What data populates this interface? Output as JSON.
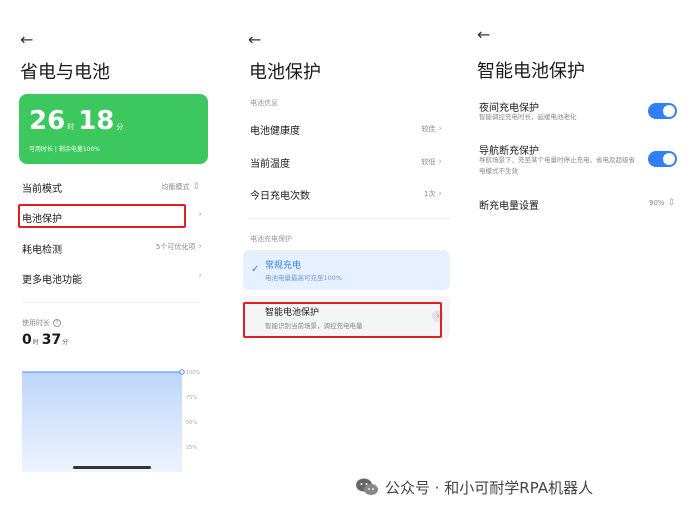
{
  "screen1": {
    "back_icon": "arrow-left-icon",
    "title": "省电与电池",
    "card": {
      "hours": "26",
      "hours_unit": "时",
      "minutes": "18",
      "minutes_unit": "分",
      "subtitle": "可用时长 | 剩余电量100%",
      "color": "#3cc85f"
    },
    "rows": [
      {
        "label": "当前模式",
        "value": "均衡模式"
      },
      {
        "label": "电池保护",
        "value": ""
      },
      {
        "label": "耗电检测",
        "value": "5个可优化项"
      },
      {
        "label": "更多电池功能",
        "value": ""
      }
    ],
    "usage": {
      "label": "使用时长",
      "hours": "0",
      "hours_unit": "时",
      "minutes": "37",
      "minutes_unit": "分"
    },
    "chart_axis": [
      "100%",
      "75%",
      "50%",
      "25%"
    ]
  },
  "screen2": {
    "back_icon": "arrow-left-icon",
    "title": "电池保护",
    "section_info": "电池信息",
    "rows": [
      {
        "label": "电池健康度",
        "value": "较佳"
      },
      {
        "label": "当前温度",
        "value": "较低"
      },
      {
        "label": "今日充电次数",
        "value": "1次"
      }
    ],
    "section_charge": "电池充电保护",
    "options": [
      {
        "title": "常规充电",
        "subtitle": "电池电量最高可充至100%",
        "selected": true
      },
      {
        "title": "智能电池保护",
        "subtitle": "智能识别当前场景，调控充电电量",
        "selected": false
      }
    ]
  },
  "screen3": {
    "back_icon": "arrow-left-icon",
    "title": "智能电池保护",
    "items": [
      {
        "title": "夜间充电保护",
        "desc": "智能调控充电时长，延缓电池老化",
        "toggle": true
      },
      {
        "title": "导航断充保护",
        "desc": "导航场景下，充至某个电量时停止充电，省电及超级省电模式不生效",
        "toggle": true
      }
    ],
    "cutoff": {
      "label": "断充电量设置",
      "value": "90%"
    }
  },
  "watermark": {
    "text": "公众号 · 和小可耐学RPA机器人"
  },
  "colors": {
    "accent": "#2f80f5",
    "green": "#3cc85f",
    "highlight": "#e02020"
  }
}
